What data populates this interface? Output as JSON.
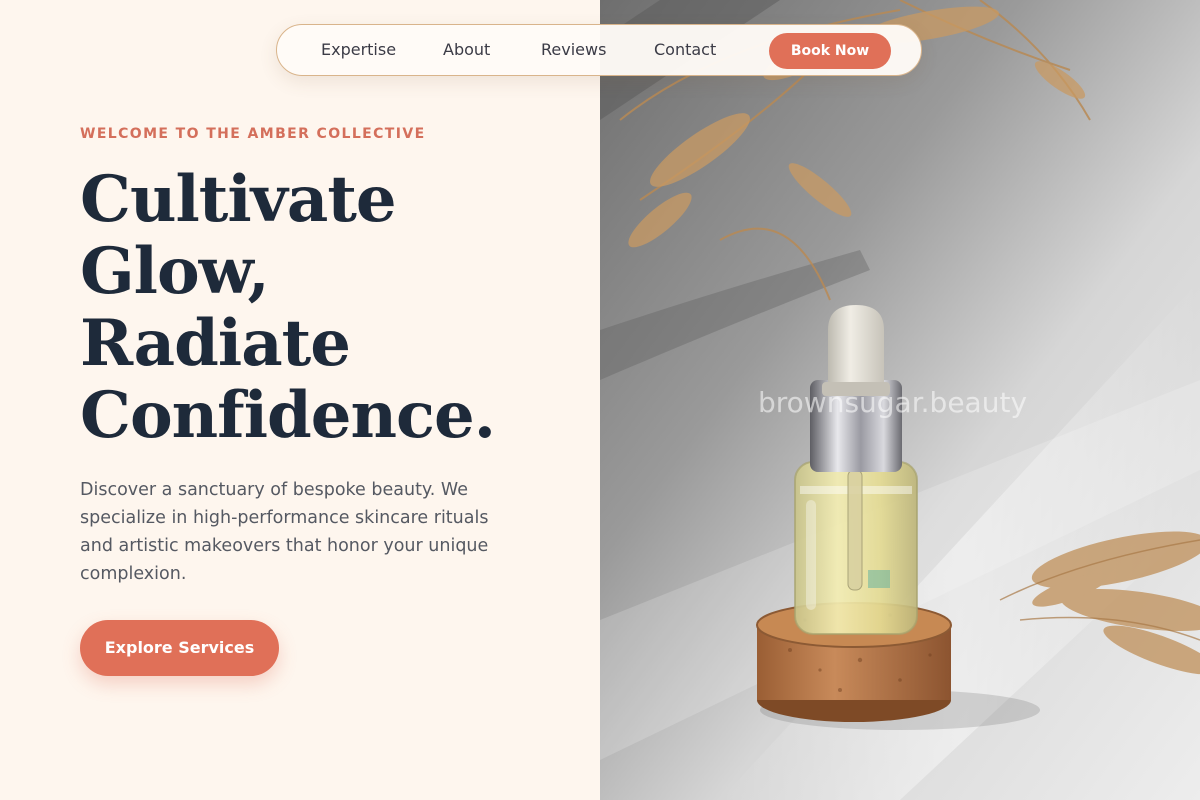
{
  "nav": {
    "links": [
      "Expertise",
      "About",
      "Reviews",
      "Contact"
    ],
    "cta_label": "Book Now"
  },
  "hero": {
    "eyebrow": "WELCOME TO THE AMBER COLLECTIVE",
    "headline_lines": [
      "Cultivate",
      "Glow,",
      "Radiate",
      "Confidence."
    ],
    "description": "Discover a sanctuary of bespoke beauty. We specialize in high-performance skincare rituals and artistic makeovers that honor your unique complexion.",
    "cta_label": "Explore Services"
  },
  "image": {
    "watermark": "brownsugar.beauty"
  },
  "colors": {
    "background": "#FEF6EE",
    "accent": "#E07058",
    "heading": "#1E2A3A",
    "body_text": "#555962",
    "nav_border": "#D9B48B"
  }
}
